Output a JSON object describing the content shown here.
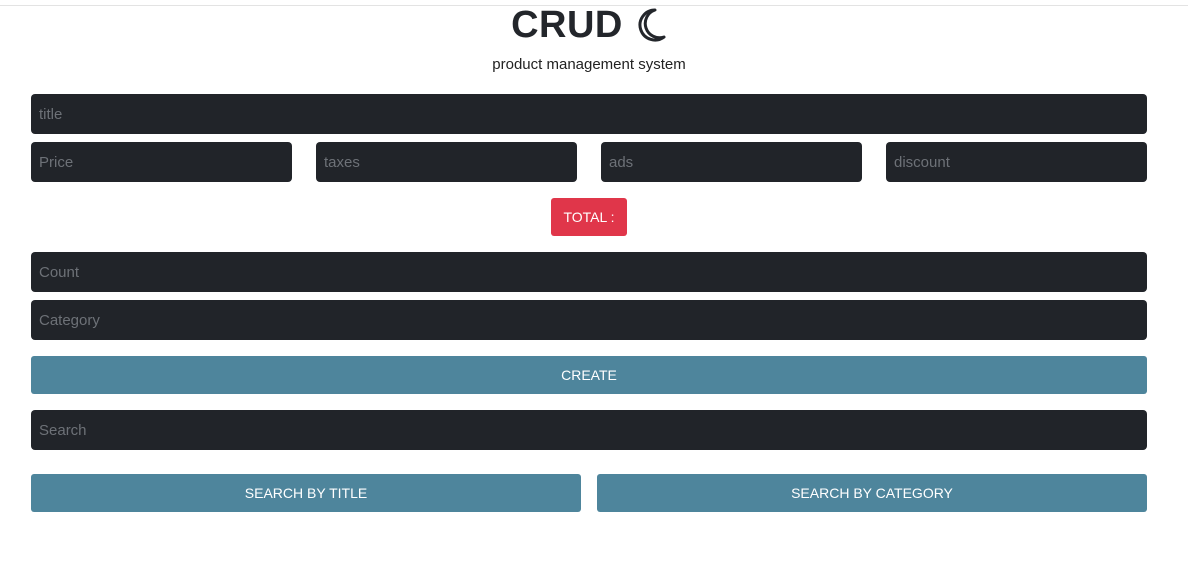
{
  "header": {
    "title": "CRUD",
    "icon": "crescent-moon-icon",
    "subtitle": "product management system"
  },
  "inputs": {
    "title_placeholder": "title",
    "price_placeholder": "Price",
    "taxes_placeholder": "taxes",
    "ads_placeholder": "ads",
    "discount_placeholder": "discount",
    "count_placeholder": "Count",
    "category_placeholder": "Category",
    "search_placeholder": "Search"
  },
  "total": {
    "label": "TOTAL :"
  },
  "buttons": {
    "create": "CREATE",
    "search_by_title": "SEARCH BY TITLE",
    "search_by_category": "SEARCH BY CATEGORY"
  },
  "colors": {
    "input_bg": "#212429",
    "button_bg": "#4e859c",
    "total_bg": "#e0364a"
  }
}
